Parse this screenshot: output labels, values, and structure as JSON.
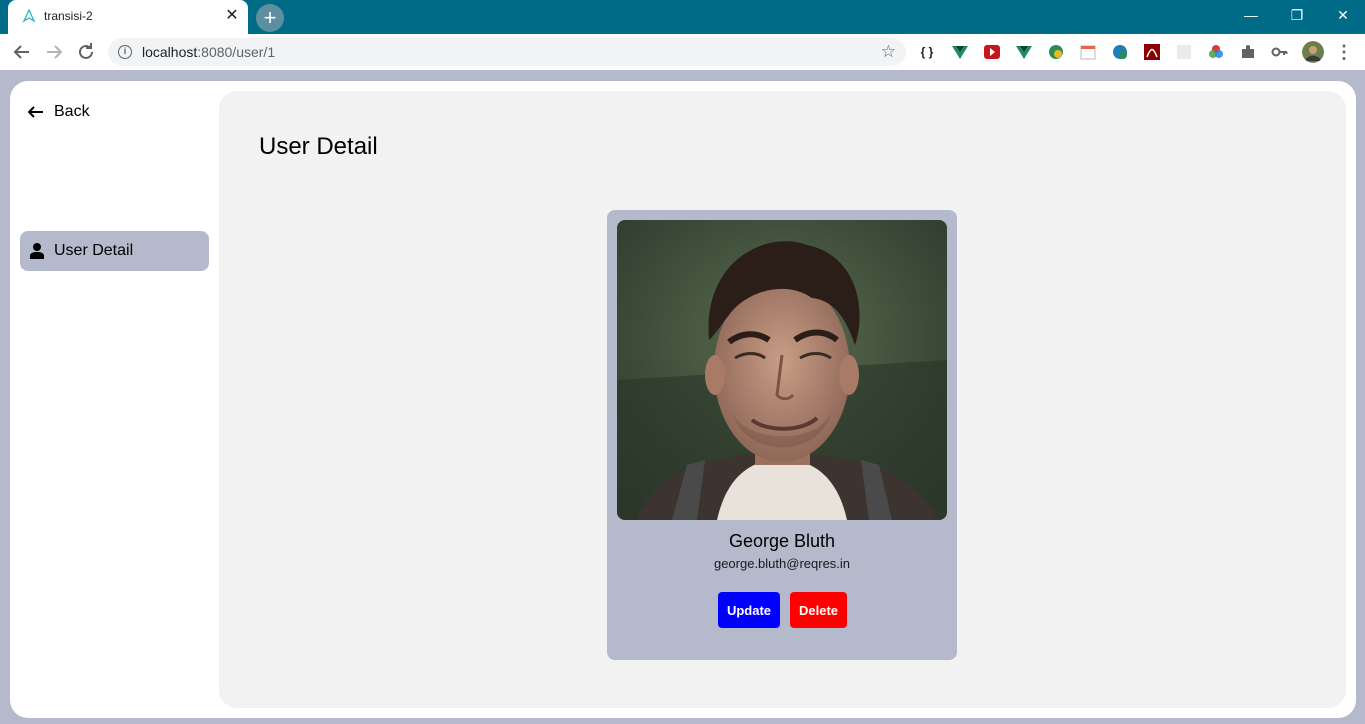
{
  "browser": {
    "tab_title": "transisi-2",
    "tab_close": "✕",
    "new_tab": "+",
    "url_host": "localhost",
    "url_path": ":8080/user/1",
    "window": {
      "minimize": "—",
      "restore": "❐",
      "close": "✕"
    },
    "extensions": [
      "braces-icon",
      "vue-devtools-icon",
      "video-icon",
      "vue-icon",
      "globe-icon",
      "calendar-icon",
      "globe-2-icon",
      "pdf-icon",
      "puzzle-gray-icon",
      "color-wheel-icon",
      "puzzle-icon",
      "key-icon",
      "profile-avatar"
    ],
    "extensions_text": {
      "braces": "{ }"
    }
  },
  "sidebar": {
    "back_label": "Back",
    "items": [
      {
        "label": "User Detail",
        "icon": "user-icon",
        "active": true
      }
    ]
  },
  "main": {
    "title": "User Detail"
  },
  "user": {
    "name": "George Bluth",
    "email": "george.bluth@reqres.in"
  },
  "actions": {
    "update_label": "Update",
    "delete_label": "Delete"
  },
  "colors": {
    "titlebar": "#006b87",
    "accent": "#b4b9cc",
    "update_button": "#0000ff",
    "delete_button": "#ff0000"
  }
}
